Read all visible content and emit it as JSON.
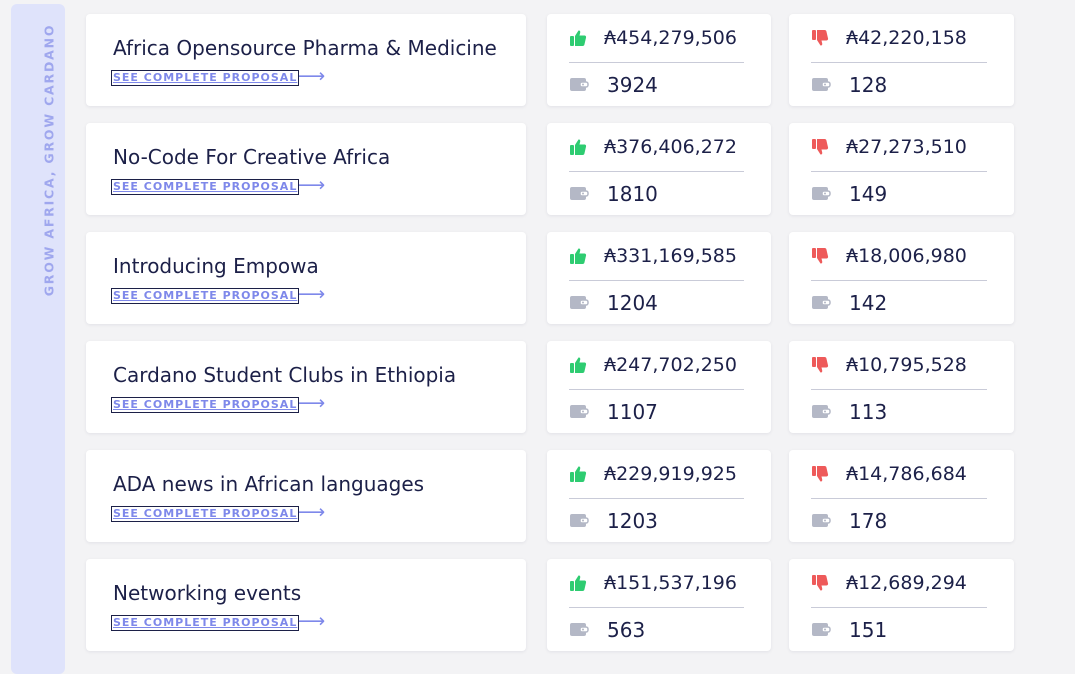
{
  "sidebar": {
    "label": "GROW AFRICA, GROW CARDANO"
  },
  "colors": {
    "yes": "#2ecc71",
    "no": "#ee5a5a",
    "accent": "#7e88ea"
  },
  "proposals": [
    {
      "title": "Africa Opensource Pharma & Medicine",
      "link": "SEE COMPLETE PROPOSAL",
      "yes_amount": "₳454,279,506",
      "yes_count": "3924",
      "no_amount": "₳42,220,158",
      "no_count": "128"
    },
    {
      "title": "No-Code For Creative Africa",
      "link": "SEE COMPLETE PROPOSAL",
      "yes_amount": "₳376,406,272",
      "yes_count": "1810",
      "no_amount": "₳27,273,510",
      "no_count": "149"
    },
    {
      "title": "Introducing Empowa",
      "link": "SEE COMPLETE PROPOSAL",
      "yes_amount": "₳331,169,585",
      "yes_count": "1204",
      "no_amount": "₳18,006,980",
      "no_count": "142"
    },
    {
      "title": "Cardano Student Clubs in Ethiopia",
      "link": "SEE COMPLETE PROPOSAL",
      "yes_amount": "₳247,702,250",
      "yes_count": "1107",
      "no_amount": "₳10,795,528",
      "no_count": "113"
    },
    {
      "title": "ADA news in African languages",
      "link": "SEE COMPLETE PROPOSAL",
      "yes_amount": "₳229,919,925",
      "yes_count": "1203",
      "no_amount": "₳14,786,684",
      "no_count": "178"
    },
    {
      "title": "Networking events",
      "link": "SEE COMPLETE PROPOSAL",
      "yes_amount": "₳151,537,196",
      "yes_count": "563",
      "no_amount": "₳12,689,294",
      "no_count": "151"
    }
  ]
}
